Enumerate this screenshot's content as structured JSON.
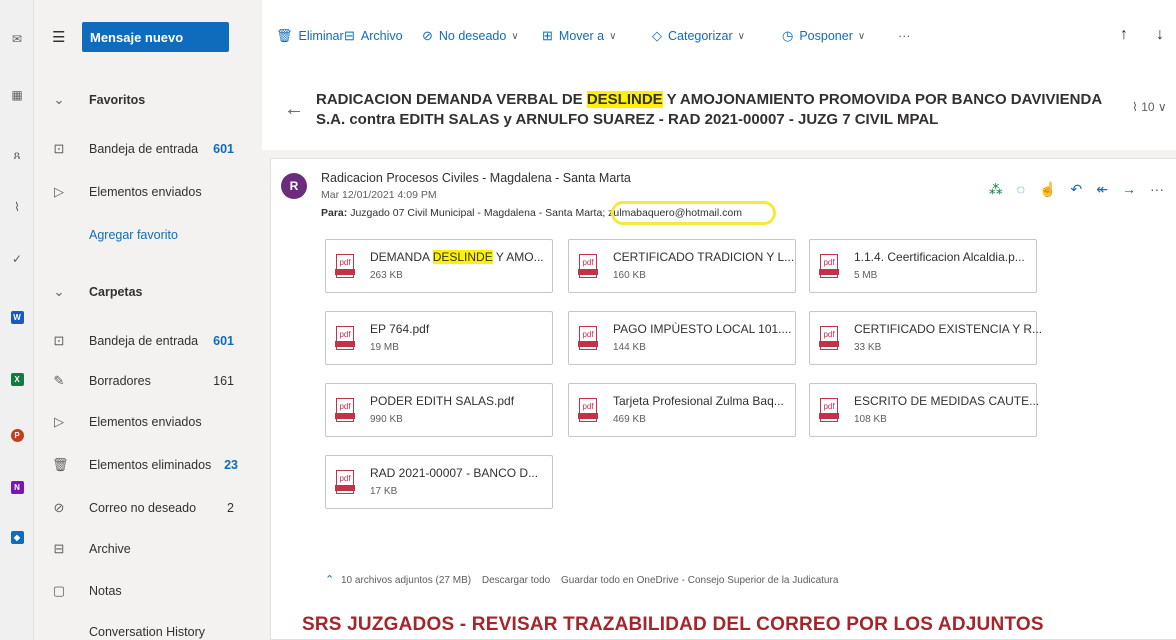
{
  "folders": {
    "new_message": "Mensaje nuevo",
    "favorites_header": "Favoritos",
    "favorites": [
      {
        "label": "Bandeja de entrada",
        "count": "601"
      },
      {
        "label": "Elementos enviados",
        "count": ""
      },
      {
        "label": "Agregar favorito",
        "count": ""
      }
    ],
    "folders_header": "Carpetas",
    "items": [
      {
        "label": "Bandeja de entrada",
        "count": "601"
      },
      {
        "label": "Borradores",
        "count": "161"
      },
      {
        "label": "Elementos enviados",
        "count": ""
      },
      {
        "label": "Elementos eliminados",
        "count": "23"
      },
      {
        "label": "Correo no deseado",
        "count": "2"
      },
      {
        "label": "Archive",
        "count": ""
      },
      {
        "label": "Notas",
        "count": ""
      },
      {
        "label": "Conversation History",
        "count": ""
      }
    ]
  },
  "toolbar": {
    "delete": "Eliminar",
    "archive": "Archivo",
    "junk": "No deseado",
    "move": "Mover a",
    "categorize": "Categorizar",
    "snooze": "Posponer",
    "more": "···"
  },
  "message": {
    "subject_part1": "RADICACION DEMANDA VERBAL DE ",
    "subject_highlight": "DESLINDE",
    "subject_part2": " Y AMOJONAMIENTO PROMOVIDA POR BANCO DAVIVIENDA S.A. contra EDITH SALAS y ARNULFO SUAREZ - RAD 2021-00007 - JUZG 7 CIVIL MPAL",
    "attachment_count_badge": "10",
    "avatar_letter": "R",
    "sender": "Radicacion Procesos Civiles - Magdalena - Santa Marta",
    "date": "Mar 12/01/2021 4:09 PM",
    "to_label": "Para:",
    "to_value": "Juzgado 07 Civil Municipal - Magdalena - Santa Marta; zulmabaquero@hotmail.com"
  },
  "attachments": [
    {
      "name_pre": "DEMANDA ",
      "name_hl": "DESLINDE",
      "name_post": " Y AMO...",
      "size": "263 KB"
    },
    {
      "name_pre": "CERTIFICADO TRADICION Y L...",
      "name_hl": "",
      "name_post": "",
      "size": "160 KB"
    },
    {
      "name_pre": "1.1.4. Ceertificacion Alcaldia.p...",
      "name_hl": "",
      "name_post": "",
      "size": "5 MB"
    },
    {
      "name_pre": "EP 764.pdf",
      "name_hl": "",
      "name_post": "",
      "size": "19 MB"
    },
    {
      "name_pre": "PAGO IMPÙESTO LOCAL 101....",
      "name_hl": "",
      "name_post": "",
      "size": "144 KB"
    },
    {
      "name_pre": "CERTIFICADO EXISTENCIA Y R...",
      "name_hl": "",
      "name_post": "",
      "size": "33 KB"
    },
    {
      "name_pre": "PODER EDITH SALAS.pdf",
      "name_hl": "",
      "name_post": "",
      "size": "990 KB"
    },
    {
      "name_pre": "Tarjeta Profesional Zulma Baq...",
      "name_hl": "",
      "name_post": "",
      "size": "469 KB"
    },
    {
      "name_pre": "ESCRITO DE MEDIDAS CAUTE...",
      "name_hl": "",
      "name_post": "",
      "size": "108 KB"
    },
    {
      "name_pre": "RAD 2021-00007 - BANCO D...",
      "name_hl": "",
      "name_post": "",
      "size": "17 KB"
    }
  ],
  "attachment_footer": {
    "summary": "10 archivos adjuntos (27 MB)",
    "download_all": "Descargar todo",
    "save_onedrive": "Guardar todo en OneDrive - Consejo Superior de la Judicatura"
  },
  "caption": "SRS JUZGADOS - REVISAR TRAZABILIDAD DEL CORREO POR LOS ADJUNTOS",
  "colors": {
    "accent": "#0f6cbd",
    "highlight": "#fff100",
    "ring": "#f5e93b",
    "caption": "#a4262c",
    "avatar": "#6b2c7d"
  }
}
